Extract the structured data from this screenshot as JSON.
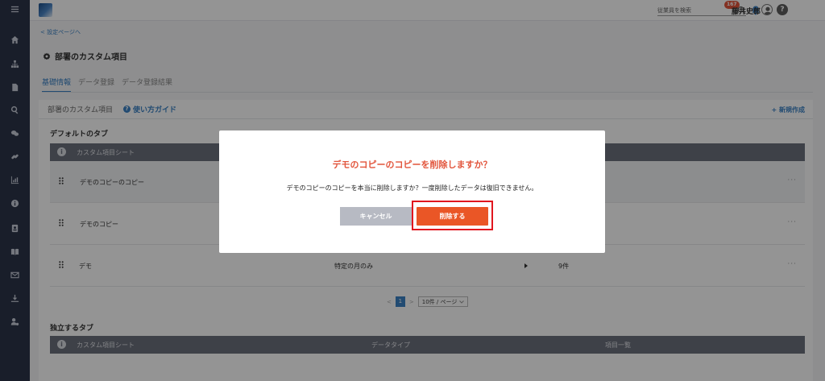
{
  "header": {
    "search_placeholder": "従業員を検索",
    "notification_count": "167",
    "user_name": "藤井史郎",
    "help_label": "?"
  },
  "sidebar": {
    "menu_icon": "menu-icon",
    "items": [
      "home-icon",
      "org-chart-icon",
      "document-icon",
      "search-icon",
      "chat-icon",
      "link-icon",
      "chart-icon",
      "info-icon",
      "id-card-icon",
      "book-icon",
      "mail-icon",
      "download-icon",
      "user-settings-icon"
    ]
  },
  "page": {
    "back_link": "< 設定ページへ",
    "title": "部署のカスタム項目",
    "tabs": [
      "基礎情報",
      "データ登録",
      "データ登録結果"
    ],
    "active_tab": 0
  },
  "panel": {
    "title": "部署のカスタム項目",
    "guide_label": "使い方ガイド",
    "guide_icon_label": "?",
    "new_label": "+ 新規作成"
  },
  "default_tabs": {
    "title": "デフォルトのタブ",
    "header_info_label": "i",
    "header_sheet": "カスタム項目シート",
    "rows": [
      {
        "name": "デモのコピーのコピー",
        "type": "",
        "count": ""
      },
      {
        "name": "デモのコピー",
        "type": "",
        "count": ""
      },
      {
        "name": "デモ",
        "type": "特定の月のみ",
        "count": "9件"
      }
    ],
    "row_menu": "···"
  },
  "pagination": {
    "prev": "<",
    "page": "1",
    "next": ">",
    "page_size": "10件 / ページ"
  },
  "independent_tabs": {
    "title": "独立するタブ",
    "header_info_label": "i",
    "header_sheet": "カスタム項目シート",
    "header_type": "データタイプ",
    "header_items": "項目一覧"
  },
  "modal": {
    "title": "デモのコピーのコピーを削除しますか？",
    "message": "デモのコピーのコピーを本当に削除しますか？一度削除したデータは復旧できません。",
    "cancel_label": "キャンセル",
    "delete_label": "削除する"
  },
  "colors": {
    "sidebar": "#2c3449",
    "accent": "#3b82c4",
    "danger": "#ea5626",
    "highlight_frame": "#e1161f"
  }
}
